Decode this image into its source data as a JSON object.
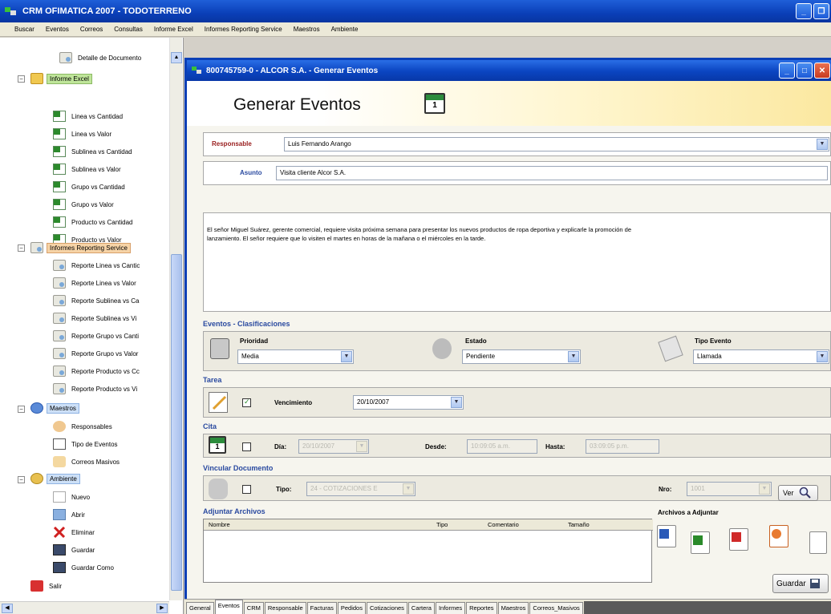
{
  "app": {
    "title": "CRM OFIMATICA 2007 - TODOTERRENO",
    "menu": [
      "Buscar",
      "Eventos",
      "Correos",
      "Consultas",
      "Informe Excel",
      "Informes Reporting Service",
      "Maestros",
      "Ambiente"
    ]
  },
  "sidebar": {
    "top_item": "Detalle de Documento",
    "groups": [
      {
        "label": "Informe Excel",
        "items": [
          "Linea vs Cantidad",
          "Linea vs Valor",
          "Sublinea vs Cantidad",
          "Sublinea vs Valor",
          "Grupo vs Cantidad",
          "Grupo vs Valor",
          "Producto vs Cantidad",
          "Producto vs Valor"
        ]
      },
      {
        "label": "Informes Reporting Service",
        "items": [
          "Reporte Linea vs Cantic",
          "Reporte Linea vs Valor",
          "Reporte Sublinea vs Ca",
          "Reporte Sublinea vs Vi",
          "Reporte Grupo vs Canti",
          "Reporte Grupo vs Valor",
          "Reporte Producto vs Cc",
          "Reporte Producto vs Vi"
        ]
      },
      {
        "label": "Maestros",
        "items": [
          "Responsables",
          "Tipo de Eventos",
          "Correos Masivos"
        ]
      },
      {
        "label": "Ambiente",
        "items": [
          "Nuevo",
          "Abrir",
          "Eliminar",
          "Guardar",
          "Guardar Como"
        ]
      }
    ],
    "exit": "Salir"
  },
  "window": {
    "title": "800745759-0 - ALCOR S.A. - Generar Eventos",
    "heading": "Generar Eventos",
    "calendar_day": "1"
  },
  "form": {
    "responsable_label": "Responsable",
    "responsable_value": "Luis Fernando Arango",
    "asunto_label": "Asunto",
    "asunto_value": "Visita cliente Alcor S.A.",
    "memo_line1": "El señor Miguel Suárez, gerente comercial, requiere visita próxima semana para presentar los nuevos productos de ropa deportiva y explicarle la promoción de",
    "memo_line2": "lanzamiento. El señor requiere que lo visiten el martes en horas de la mañana o el miércoles en la tarde.",
    "clasif_label": "Eventos - Clasificaciones",
    "prioridad_label": "Prioridad",
    "prioridad_value": "Media",
    "estado_label": "Estado",
    "estado_value": "Pendiente",
    "tipo_evento_label": "Tipo Evento",
    "tipo_evento_value": "Llamada",
    "tarea_label": "Tarea",
    "tarea_checked": true,
    "vencimiento_label": "Vencimiento",
    "vencimiento_value": "20/10/2007",
    "cita_label": "Cita",
    "cita_checked": false,
    "dia_label": "Día:",
    "dia_value": "20/10/2007",
    "desde_label": "Desde:",
    "desde_value": "10:09:05 a.m.",
    "hasta_label": "Hasta:",
    "hasta_value": "03:09:05 p.m.",
    "vincular_label": "Vincular Documento",
    "vincular_checked": false,
    "tipo_label": "Tipo:",
    "tipo_value": "24 - COTIZACIONES E",
    "nro_label": "Nro:",
    "nro_value": "1001",
    "ver_label": "Ver",
    "adjuntar_label": "Adjuntar Archivos",
    "grid_columns": [
      "Nombre",
      "Tipo",
      "Comentario",
      "Tamaño"
    ],
    "archivos_label": "Archivos a Adjuntar",
    "guardar_label": "Guardar"
  },
  "tabs": [
    "General",
    "Eventos",
    "CRM",
    "Responsable",
    "Facturas",
    "Pedidos",
    "Cotizaciones",
    "Cartera",
    "Informes",
    "Reportes",
    "Maestros",
    "Correos_Masivos"
  ],
  "active_tab": "Eventos"
}
